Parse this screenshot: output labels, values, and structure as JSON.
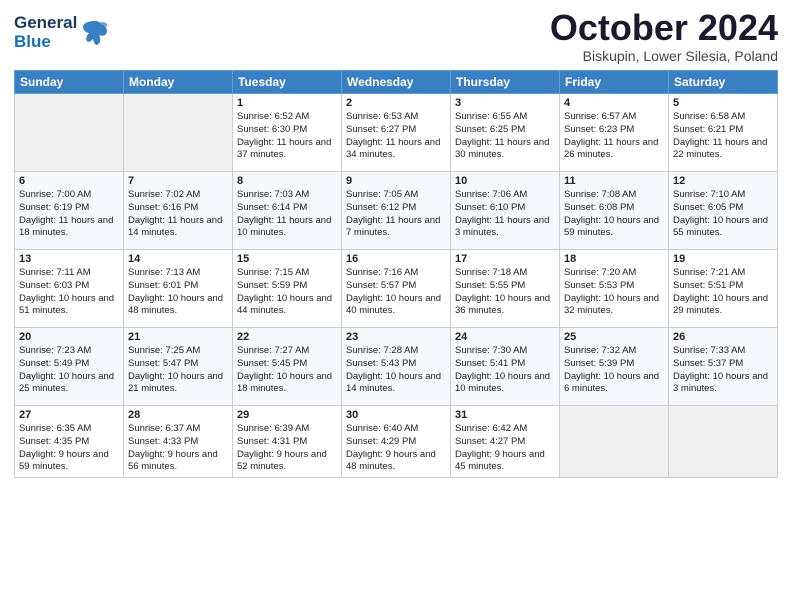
{
  "header": {
    "logo_line1": "General",
    "logo_line2": "Blue",
    "month": "October 2024",
    "location": "Biskupin, Lower Silesia, Poland"
  },
  "days_of_week": [
    "Sunday",
    "Monday",
    "Tuesday",
    "Wednesday",
    "Thursday",
    "Friday",
    "Saturday"
  ],
  "weeks": [
    [
      {
        "day": "",
        "empty": true
      },
      {
        "day": "",
        "empty": true
      },
      {
        "day": "1",
        "sunrise": "Sunrise: 6:52 AM",
        "sunset": "Sunset: 6:30 PM",
        "daylight": "Daylight: 11 hours and 37 minutes."
      },
      {
        "day": "2",
        "sunrise": "Sunrise: 6:53 AM",
        "sunset": "Sunset: 6:27 PM",
        "daylight": "Daylight: 11 hours and 34 minutes."
      },
      {
        "day": "3",
        "sunrise": "Sunrise: 6:55 AM",
        "sunset": "Sunset: 6:25 PM",
        "daylight": "Daylight: 11 hours and 30 minutes."
      },
      {
        "day": "4",
        "sunrise": "Sunrise: 6:57 AM",
        "sunset": "Sunset: 6:23 PM",
        "daylight": "Daylight: 11 hours and 26 minutes."
      },
      {
        "day": "5",
        "sunrise": "Sunrise: 6:58 AM",
        "sunset": "Sunset: 6:21 PM",
        "daylight": "Daylight: 11 hours and 22 minutes."
      }
    ],
    [
      {
        "day": "6",
        "sunrise": "Sunrise: 7:00 AM",
        "sunset": "Sunset: 6:19 PM",
        "daylight": "Daylight: 11 hours and 18 minutes."
      },
      {
        "day": "7",
        "sunrise": "Sunrise: 7:02 AM",
        "sunset": "Sunset: 6:16 PM",
        "daylight": "Daylight: 11 hours and 14 minutes."
      },
      {
        "day": "8",
        "sunrise": "Sunrise: 7:03 AM",
        "sunset": "Sunset: 6:14 PM",
        "daylight": "Daylight: 11 hours and 10 minutes."
      },
      {
        "day": "9",
        "sunrise": "Sunrise: 7:05 AM",
        "sunset": "Sunset: 6:12 PM",
        "daylight": "Daylight: 11 hours and 7 minutes."
      },
      {
        "day": "10",
        "sunrise": "Sunrise: 7:06 AM",
        "sunset": "Sunset: 6:10 PM",
        "daylight": "Daylight: 11 hours and 3 minutes."
      },
      {
        "day": "11",
        "sunrise": "Sunrise: 7:08 AM",
        "sunset": "Sunset: 6:08 PM",
        "daylight": "Daylight: 10 hours and 59 minutes."
      },
      {
        "day": "12",
        "sunrise": "Sunrise: 7:10 AM",
        "sunset": "Sunset: 6:05 PM",
        "daylight": "Daylight: 10 hours and 55 minutes."
      }
    ],
    [
      {
        "day": "13",
        "sunrise": "Sunrise: 7:11 AM",
        "sunset": "Sunset: 6:03 PM",
        "daylight": "Daylight: 10 hours and 51 minutes."
      },
      {
        "day": "14",
        "sunrise": "Sunrise: 7:13 AM",
        "sunset": "Sunset: 6:01 PM",
        "daylight": "Daylight: 10 hours and 48 minutes."
      },
      {
        "day": "15",
        "sunrise": "Sunrise: 7:15 AM",
        "sunset": "Sunset: 5:59 PM",
        "daylight": "Daylight: 10 hours and 44 minutes."
      },
      {
        "day": "16",
        "sunrise": "Sunrise: 7:16 AM",
        "sunset": "Sunset: 5:57 PM",
        "daylight": "Daylight: 10 hours and 40 minutes."
      },
      {
        "day": "17",
        "sunrise": "Sunrise: 7:18 AM",
        "sunset": "Sunset: 5:55 PM",
        "daylight": "Daylight: 10 hours and 36 minutes."
      },
      {
        "day": "18",
        "sunrise": "Sunrise: 7:20 AM",
        "sunset": "Sunset: 5:53 PM",
        "daylight": "Daylight: 10 hours and 32 minutes."
      },
      {
        "day": "19",
        "sunrise": "Sunrise: 7:21 AM",
        "sunset": "Sunset: 5:51 PM",
        "daylight": "Daylight: 10 hours and 29 minutes."
      }
    ],
    [
      {
        "day": "20",
        "sunrise": "Sunrise: 7:23 AM",
        "sunset": "Sunset: 5:49 PM",
        "daylight": "Daylight: 10 hours and 25 minutes."
      },
      {
        "day": "21",
        "sunrise": "Sunrise: 7:25 AM",
        "sunset": "Sunset: 5:47 PM",
        "daylight": "Daylight: 10 hours and 21 minutes."
      },
      {
        "day": "22",
        "sunrise": "Sunrise: 7:27 AM",
        "sunset": "Sunset: 5:45 PM",
        "daylight": "Daylight: 10 hours and 18 minutes."
      },
      {
        "day": "23",
        "sunrise": "Sunrise: 7:28 AM",
        "sunset": "Sunset: 5:43 PM",
        "daylight": "Daylight: 10 hours and 14 minutes."
      },
      {
        "day": "24",
        "sunrise": "Sunrise: 7:30 AM",
        "sunset": "Sunset: 5:41 PM",
        "daylight": "Daylight: 10 hours and 10 minutes."
      },
      {
        "day": "25",
        "sunrise": "Sunrise: 7:32 AM",
        "sunset": "Sunset: 5:39 PM",
        "daylight": "Daylight: 10 hours and 6 minutes."
      },
      {
        "day": "26",
        "sunrise": "Sunrise: 7:33 AM",
        "sunset": "Sunset: 5:37 PM",
        "daylight": "Daylight: 10 hours and 3 minutes."
      }
    ],
    [
      {
        "day": "27",
        "sunrise": "Sunrise: 6:35 AM",
        "sunset": "Sunset: 4:35 PM",
        "daylight": "Daylight: 9 hours and 59 minutes."
      },
      {
        "day": "28",
        "sunrise": "Sunrise: 6:37 AM",
        "sunset": "Sunset: 4:33 PM",
        "daylight": "Daylight: 9 hours and 56 minutes."
      },
      {
        "day": "29",
        "sunrise": "Sunrise: 6:39 AM",
        "sunset": "Sunset: 4:31 PM",
        "daylight": "Daylight: 9 hours and 52 minutes."
      },
      {
        "day": "30",
        "sunrise": "Sunrise: 6:40 AM",
        "sunset": "Sunset: 4:29 PM",
        "daylight": "Daylight: 9 hours and 48 minutes."
      },
      {
        "day": "31",
        "sunrise": "Sunrise: 6:42 AM",
        "sunset": "Sunset: 4:27 PM",
        "daylight": "Daylight: 9 hours and 45 minutes."
      },
      {
        "day": "",
        "empty": true
      },
      {
        "day": "",
        "empty": true
      }
    ]
  ]
}
